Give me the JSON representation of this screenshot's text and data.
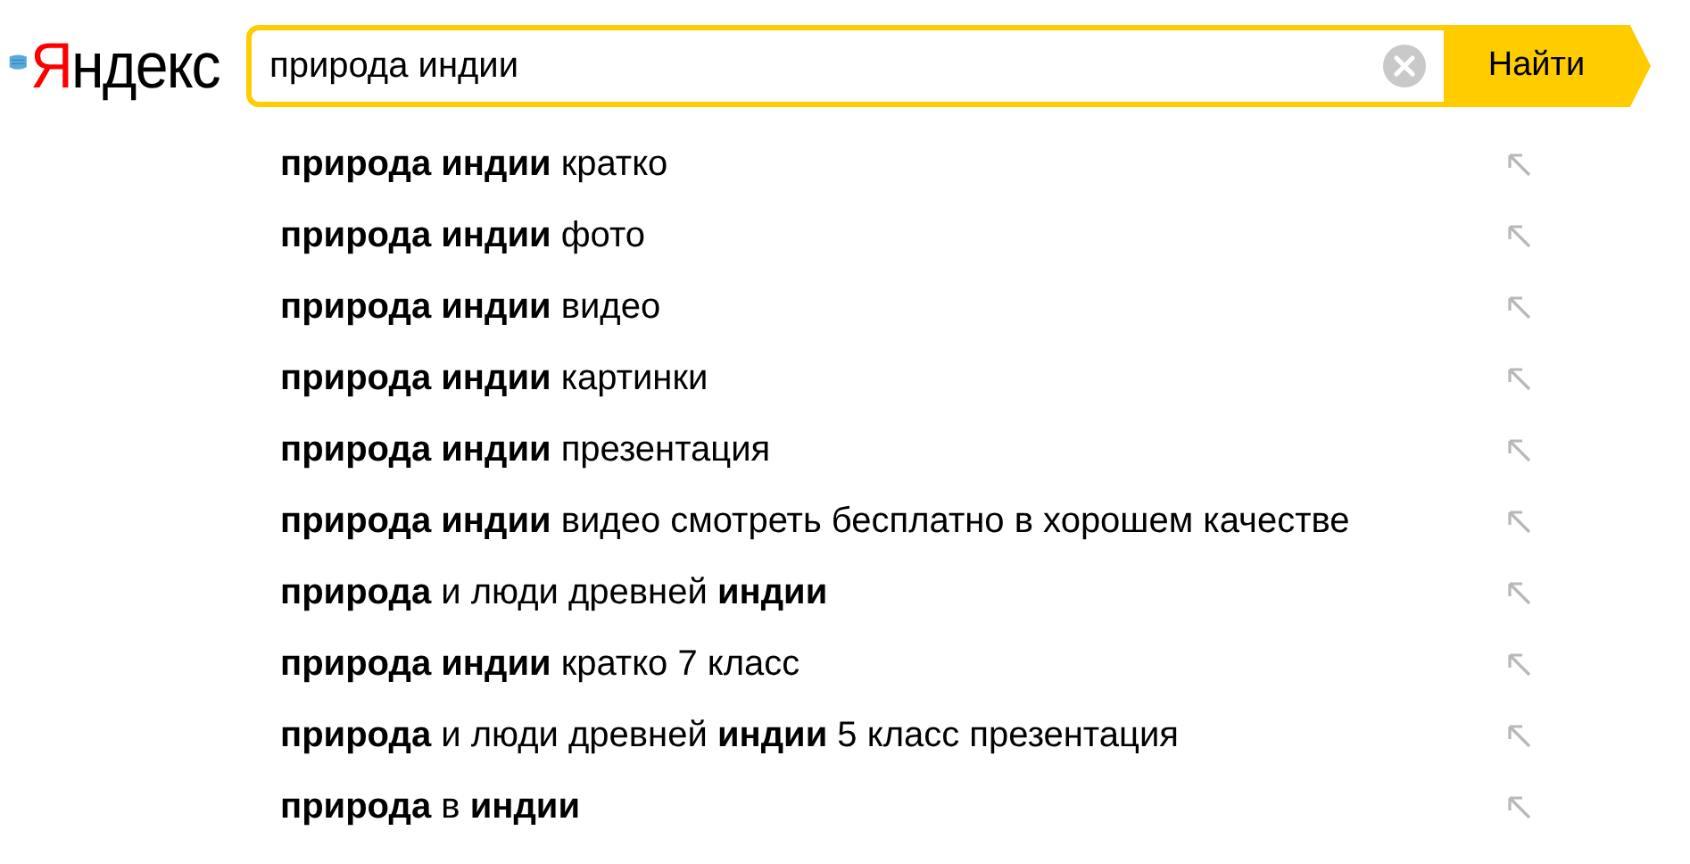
{
  "logo": {
    "first_letter": "Я",
    "rest": "ндекс"
  },
  "search": {
    "value": "природа индии",
    "button": "Найти"
  },
  "suggestions": [
    "**природа индии** кратко",
    "**природа индии** фото",
    "**природа индии** видео",
    "**природа индии** картинки",
    "**природа индии** презентация",
    "**природа индии** видео смотреть бесплатно в хорошем качестве",
    "**природа** и люди древней **индии**",
    "**природа индии** кратко 7 класс",
    "**природа** и люди древней **индии** 5 класс презентация",
    "**природа** в **индии**"
  ]
}
